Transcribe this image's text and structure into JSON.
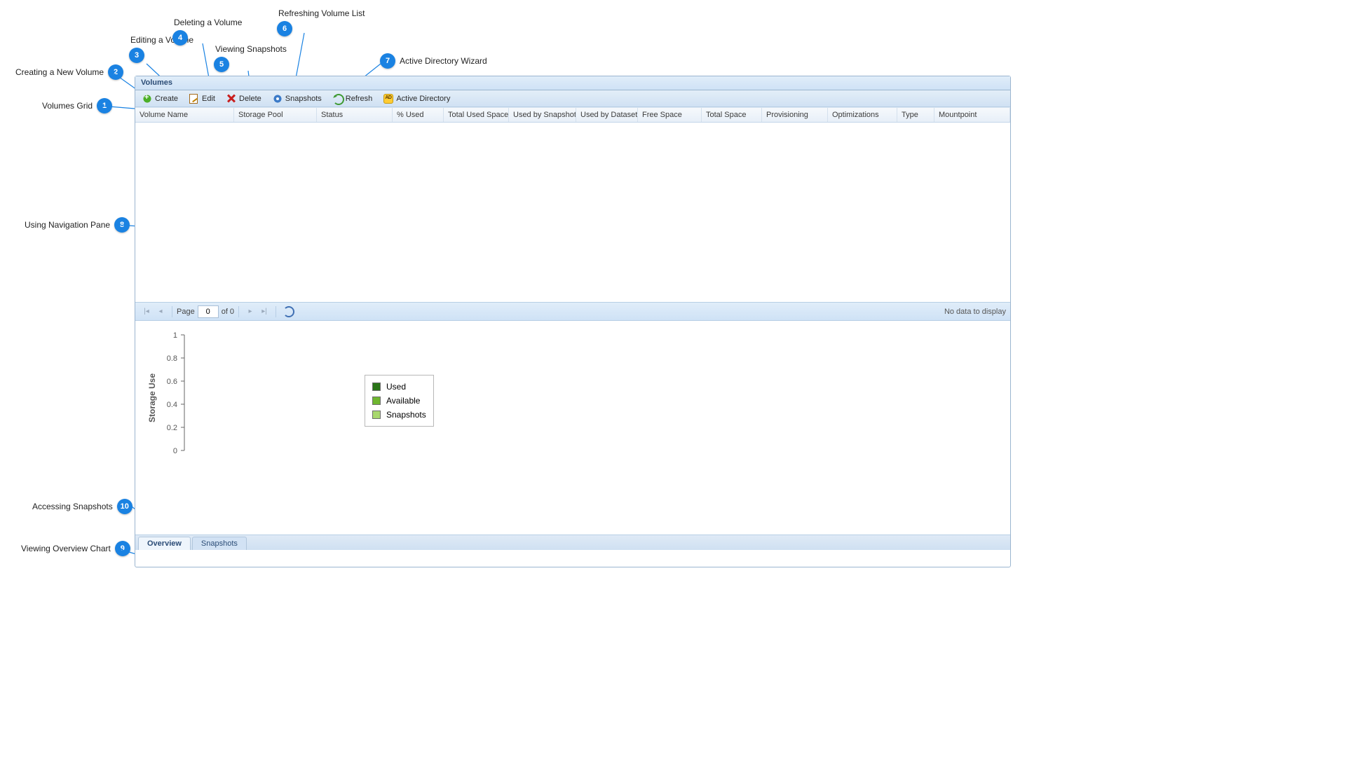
{
  "panel": {
    "title": "Volumes"
  },
  "toolbar": {
    "create": "Create",
    "edit": "Edit",
    "delete": "Delete",
    "snapshots": "Snapshots",
    "refresh": "Refresh",
    "active_directory": "Active Directory"
  },
  "columns": [
    "Volume Name",
    "Storage Pool",
    "Status",
    "% Used",
    "Total Used Space",
    "Used by Snapshots",
    "Used by Dataset",
    "Free Space",
    "Total Space",
    "Provisioning",
    "Optimizations",
    "Type",
    "Mountpoint"
  ],
  "pager": {
    "page_label": "Page",
    "page_value": "0",
    "of_label": "of 0",
    "empty_text": "No data to display"
  },
  "tabs": {
    "overview": "Overview",
    "snapshots": "Snapshots"
  },
  "callouts": {
    "c1": "Volumes Grid",
    "c2": "Creating a New Volume",
    "c3": "Editing a Volume",
    "c4": "Deleting a Volume",
    "c5": "Viewing Snapshots",
    "c6": "Refreshing Volume List",
    "c7": "Active Directory Wizard",
    "c8": "Using Navigation Pane",
    "c9": "Viewing Overview Chart",
    "c10": "Accessing Snapshots"
  },
  "chart_data": {
    "type": "bar",
    "title": "",
    "ylabel": "Storage Use",
    "xlabel": "",
    "ylim": [
      0,
      1
    ],
    "yticks": [
      0,
      0.2,
      0.4,
      0.6,
      0.8,
      1
    ],
    "categories": [],
    "series": [
      {
        "name": "Used",
        "color": "#2a7518",
        "values": []
      },
      {
        "name": "Available",
        "color": "#6fb72f",
        "values": []
      },
      {
        "name": "Snapshots",
        "color": "#a9d86e",
        "values": []
      }
    ]
  }
}
